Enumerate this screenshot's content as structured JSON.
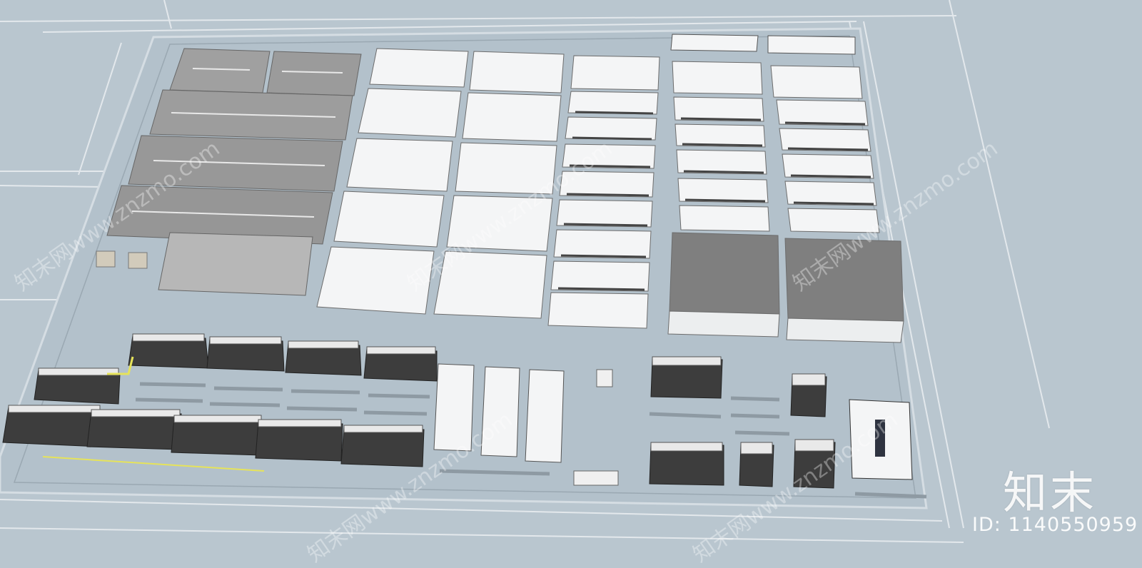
{
  "watermark": {
    "brand": "知末",
    "id_label": "ID: 1140550959",
    "diagonal_text": "知末网www.znzmo.com"
  },
  "colors": {
    "ground": "#b9c6cf",
    "plaza": "#aebcc6",
    "white_roof": "#f4f5f6",
    "grey_roof": "#9a9a9a",
    "dark_roof": "#7d7d7d",
    "tower": "#3a3a3a"
  }
}
